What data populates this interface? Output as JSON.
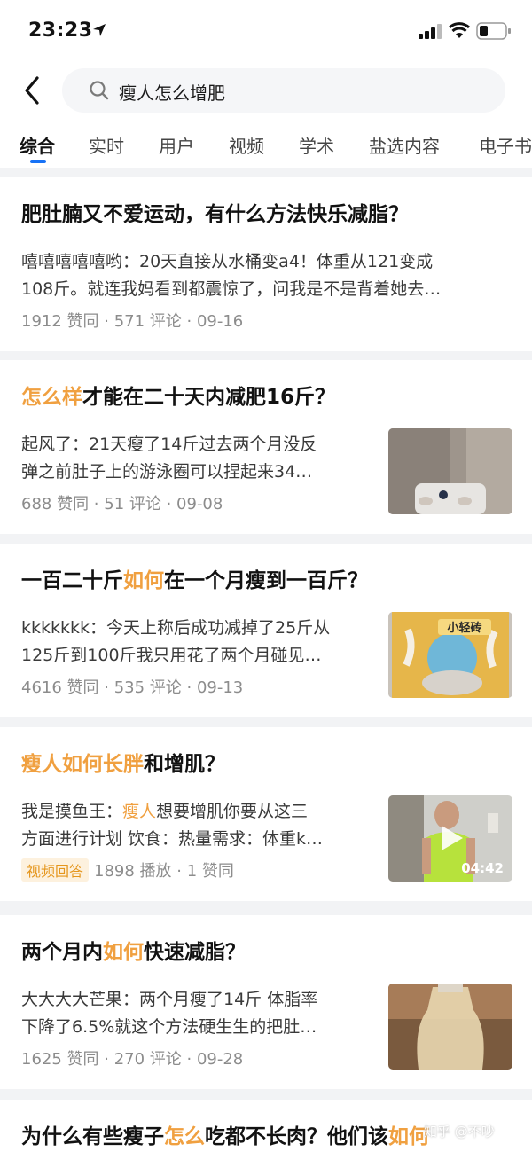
{
  "status_bar": {
    "time": "23:23"
  },
  "search": {
    "query": "瘦人怎么增肥"
  },
  "tabs": [
    "综合",
    "实时",
    "用户",
    "视频",
    "学术",
    "盐选内容",
    "电子书"
  ],
  "results": [
    {
      "title_parts": [
        "肥肚腩又不爱运动，有什么方法快乐减脂？"
      ],
      "excerpt_lines": [
        "嘻嘻嘻嘻嘻哟：20天直接从水桶变a4！体重从121变成",
        "108斤。就连我妈看到都震惊了，问我是不是背着她去…"
      ],
      "meta": "1912 赞同 · 571 评论 · 09-16"
    },
    {
      "title_parts": [
        "怎么样",
        "才能在二十天内减肥16斤？"
      ],
      "excerpt_lines": [
        "起风了：21天瘦了14斤过去两个月没反",
        "弹之前肚子上的游泳圈可以捏起来34…"
      ],
      "meta": "688 赞同 · 51 评论 · 09-08"
    },
    {
      "title_parts": [
        "一百二十斤",
        "如何",
        "在一个月瘦到一百斤？"
      ],
      "excerpt_lines": [
        "kkkkkkk：今天上称后成功减掉了25斤从",
        "125斤到100斤我只用花了两个月碰见…"
      ],
      "meta": "4616 赞同 · 535 评论 · 09-13",
      "thumb_text": "小轻砖"
    },
    {
      "title_parts": [
        "瘦人如何长胖",
        "和增肌？"
      ],
      "excerpt_lines": [
        "我是摸鱼王：",
        "瘦人",
        "想要增肌你要从这三",
        "方面进行计划 饮食：热量需求：体重k…"
      ],
      "badge": "视频回答",
      "meta": "1898 播放 · 1 赞同",
      "duration": "04:42"
    },
    {
      "title_parts": [
        "两个月内",
        "如何",
        "快速减脂？"
      ],
      "excerpt_lines": [
        "大大大大芒果：两个月瘦了14斤 体脂率",
        "下降了6.5%就这个方法硬生生的把肚…"
      ],
      "meta": "1625 赞同 · 270 评论 · 09-28"
    },
    {
      "title_parts": [
        "为什么有些瘦子",
        "怎么",
        "吃都不长肉？他们该",
        "如何"
      ]
    }
  ],
  "watermark": "知乎 @不吵",
  "colors": {
    "highlight": "#f0a040",
    "tab_indicator": "#1772f6",
    "badge_bg": "#fdf1de"
  }
}
